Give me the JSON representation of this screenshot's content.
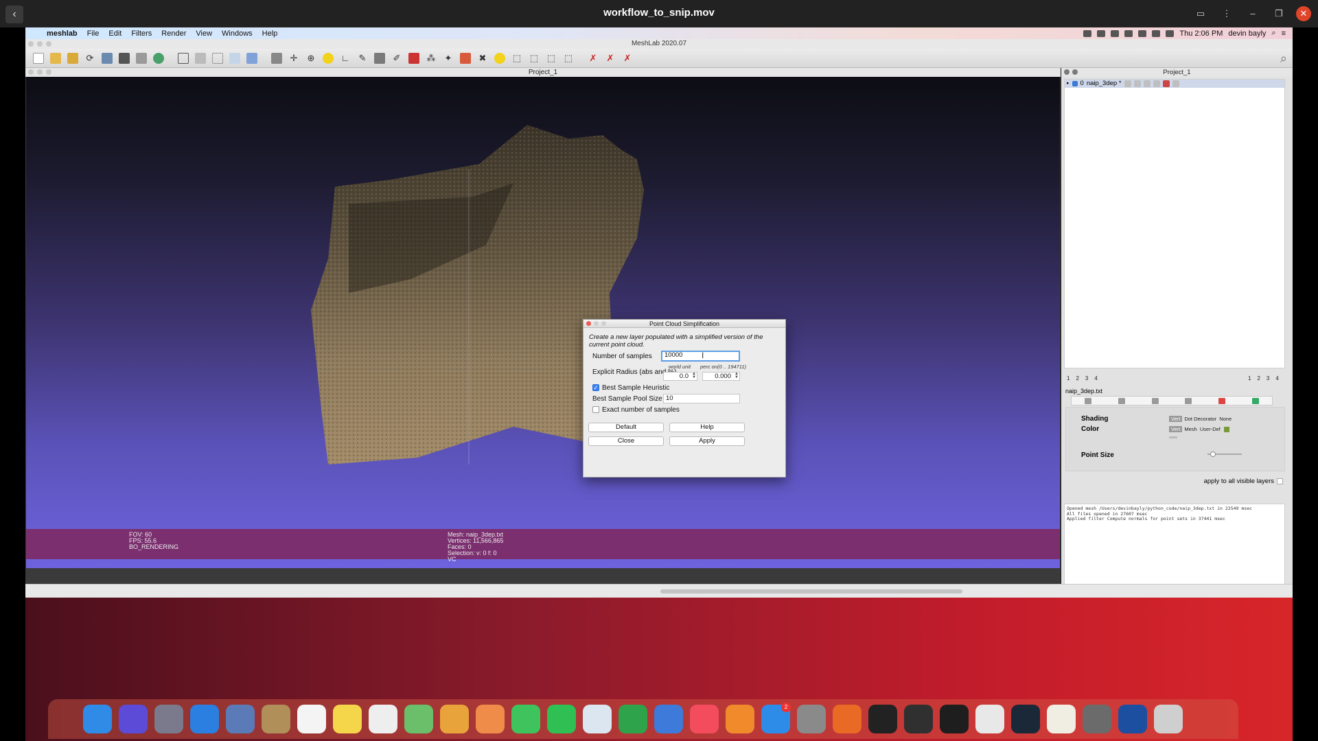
{
  "player": {
    "title": "workflow_to_snip.mov",
    "back": "‹"
  },
  "menubar": {
    "app": "meshlab",
    "items": [
      "File",
      "Edit",
      "Filters",
      "Render",
      "View",
      "Windows",
      "Help"
    ],
    "clock": "Thu 2:06 PM",
    "user": "devin bayly"
  },
  "window_title": "MeshLab 2020.07",
  "viewport": {
    "title": "Project_1",
    "status_left": [
      "FOV: 60",
      "FPS:   55.6",
      "BO_RENDERING"
    ],
    "status_mid": [
      "Mesh: naip_3dep.txt",
      "Vertices: 11,566,865",
      "Faces: 0",
      "Selection: v: 0 f: 0",
      "VC"
    ]
  },
  "dialog": {
    "title": "Point Cloud Simplification",
    "description": "Create a new layer populated with a simplified version of the current point cloud.",
    "num_samples_label": "Number of samples",
    "num_samples_value": "10000",
    "world_unit": "world unit",
    "perc_on": "perc on(0 .. 194711)",
    "radius_label": "Explicit Radius (abs and %)",
    "radius_abs": "0.0",
    "radius_perc": "0.000",
    "heuristic_label": "Best Sample Heuristic",
    "heuristic_checked": true,
    "pool_label": "Best Sample Pool Size",
    "pool_value": "10",
    "exact_label": "Exact number of samples",
    "exact_checked": false,
    "default_btn": "Default",
    "help_btn": "Help",
    "close_btn": "Close",
    "apply_btn": "Apply"
  },
  "right_panel": {
    "title": "Project_1",
    "layer": {
      "index": "0",
      "name": "naip_3dep *"
    },
    "nums_left": [
      "1",
      "2",
      "3",
      "4"
    ],
    "nums_right": [
      "1",
      "2",
      "3",
      "4"
    ],
    "mesh_name": "naip_3dep.txt",
    "shading_label": "Shading",
    "shading_opts": [
      "Vert",
      "Dot Decorator",
      "None"
    ],
    "color_label": "Color",
    "color_opts": [
      "Vert",
      "Mesh",
      "User-Def"
    ],
    "point_size_label": "Point Size",
    "point_size_level": 0.1,
    "apply_all_label": "apply to all visible layers",
    "log": [
      "Opened mesh /Users/devinbayly/python_code/naip_3dep.txt in 22549 msec",
      "All files opened in 27607 msec",
      "Applied filter Compute normals for point sets in 37441 msec"
    ]
  },
  "dock": {
    "items": [
      {
        "name": "finder",
        "color": "#2f8be6"
      },
      {
        "name": "siri",
        "color": "#5b4bd6"
      },
      {
        "name": "launchpad",
        "color": "#7a7a8c"
      },
      {
        "name": "safari",
        "color": "#2a7fe0"
      },
      {
        "name": "preview",
        "color": "#5a7ab8"
      },
      {
        "name": "notes-book",
        "color": "#b08f58"
      },
      {
        "name": "calendar",
        "color": "#f4f4f4"
      },
      {
        "name": "notes",
        "color": "#f5d54a"
      },
      {
        "name": "reminders",
        "color": "#eeeeee"
      },
      {
        "name": "maps",
        "color": "#6cbf6a"
      },
      {
        "name": "meshlab",
        "color": "#e8a43a"
      },
      {
        "name": "photos",
        "color": "#f08c4a"
      },
      {
        "name": "messages",
        "color": "#3fc35c"
      },
      {
        "name": "facetime",
        "color": "#2fbf52"
      },
      {
        "name": "keynote-doc",
        "color": "#dbe6f0"
      },
      {
        "name": "numbers",
        "color": "#2ea34b"
      },
      {
        "name": "keynote",
        "color": "#3d7ad9"
      },
      {
        "name": "music",
        "color": "#f24c5d"
      },
      {
        "name": "books",
        "color": "#f08a2a"
      },
      {
        "name": "app-store",
        "color": "#2d8ce8",
        "badge": "2"
      },
      {
        "name": "system-preferences",
        "color": "#8a8a8a"
      },
      {
        "name": "firefox",
        "color": "#e86a24"
      },
      {
        "name": "activity-monitor",
        "color": "#222222"
      },
      {
        "name": "obs",
        "color": "#303030"
      },
      {
        "name": "terminal",
        "color": "#1e1e1e"
      },
      {
        "name": "chrome",
        "color": "#e8e8e8"
      },
      {
        "name": "steam",
        "color": "#1b2838"
      },
      {
        "name": "textedit",
        "color": "#f0ede2"
      },
      {
        "name": "blender-eye",
        "color": "#6b6b6b"
      },
      {
        "name": "quicktime",
        "color": "#1c4fa0"
      },
      {
        "name": "trash",
        "color": "#cfcfcf"
      }
    ]
  }
}
